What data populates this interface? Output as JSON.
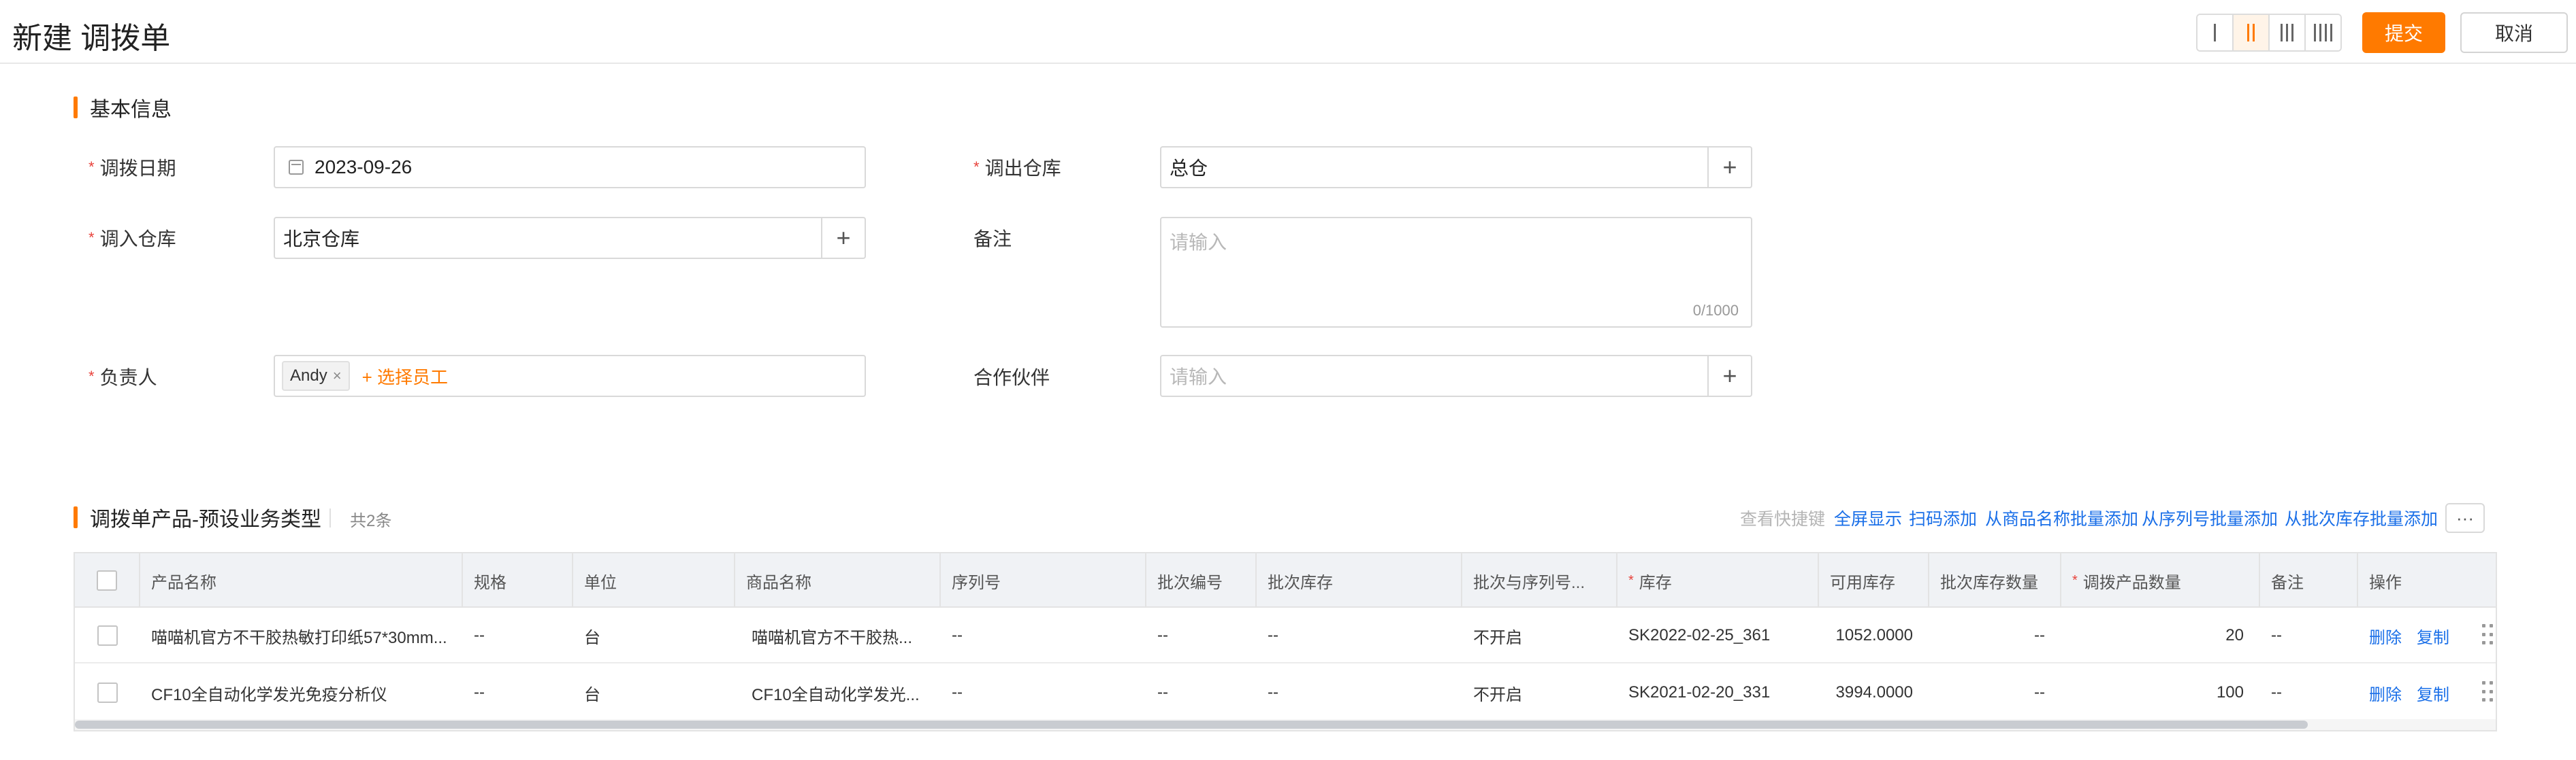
{
  "header": {
    "title": "新建 调拨单",
    "submit_label": "提交",
    "cancel_label": "取消",
    "layout_options": [
      {
        "icon": "one-column-icon",
        "bars": 1,
        "active": false
      },
      {
        "icon": "two-column-icon",
        "bars": 2,
        "active": true
      },
      {
        "icon": "three-column-icon",
        "bars": 3,
        "active": false
      },
      {
        "icon": "four-column-icon",
        "bars": 4,
        "active": false
      }
    ],
    "accent_color": "#ff7a00"
  },
  "basic_info": {
    "section_title": "基本信息",
    "transfer_date": {
      "label": "调拨日期",
      "value": "2023-09-26"
    },
    "out_warehouse": {
      "label": "调出仓库",
      "value": "总仓"
    },
    "in_warehouse": {
      "label": "调入仓库",
      "value": "北京仓库"
    },
    "remark": {
      "label": "备注",
      "placeholder": "请输入",
      "counter": "0/1000"
    },
    "owner": {
      "label": "负责人",
      "tag": "Andy",
      "choose_label": "+ 选择员工"
    },
    "partner": {
      "label": "合作伙伴",
      "placeholder": "请输入"
    }
  },
  "products": {
    "section_title": "调拨单产品-预设业务类型",
    "count_text": "共2条",
    "toolbar": {
      "shortcut": "查看快捷键",
      "fullscreen": "全屏显示",
      "scan_add": "扫码添加",
      "by_name": "从商品名称批量添加",
      "by_serial": "从序列号批量添加",
      "by_batch": "从批次库存批量添加",
      "more": "···"
    },
    "columns": [
      {
        "label": "产品名称",
        "required": false
      },
      {
        "label": "规格",
        "required": false
      },
      {
        "label": "单位",
        "required": false
      },
      {
        "label": "商品名称",
        "required": false
      },
      {
        "label": "序列号",
        "required": false
      },
      {
        "label": "批次编号",
        "required": false
      },
      {
        "label": "批次库存",
        "required": false
      },
      {
        "label": "批次与序列号...",
        "required": false
      },
      {
        "label": "库存",
        "required": true
      },
      {
        "label": "可用库存",
        "required": false
      },
      {
        "label": "批次库存数量",
        "required": false
      },
      {
        "label": "调拨产品数量",
        "required": true
      },
      {
        "label": "备注",
        "required": false
      },
      {
        "label": "操作",
        "required": false
      }
    ],
    "rows": [
      {
        "product_name": "喵喵机官方不干胶热敏打印纸57*30mm...",
        "spec": "--",
        "unit": "台",
        "goods_name": "喵喵机官方不干胶热...",
        "serial": "--",
        "batch_no": "--",
        "batch_stock": "--",
        "batch_serial": "不开启",
        "stock": "SK2022-02-25_361",
        "available": "1052.0000",
        "batch_qty": "--",
        "transfer_qty": "20",
        "remark": "--",
        "delete_label": "删除",
        "copy_label": "复制"
      },
      {
        "product_name": "CF10全自动化学发光免疫分析仪",
        "spec": "--",
        "unit": "台",
        "goods_name": "CF10全自动化学发光...",
        "serial": "--",
        "batch_no": "--",
        "batch_stock": "--",
        "batch_serial": "不开启",
        "stock": "SK2021-02-20_331",
        "available": "3994.0000",
        "batch_qty": "--",
        "transfer_qty": "100",
        "remark": "--",
        "delete_label": "删除",
        "copy_label": "复制"
      }
    ]
  }
}
